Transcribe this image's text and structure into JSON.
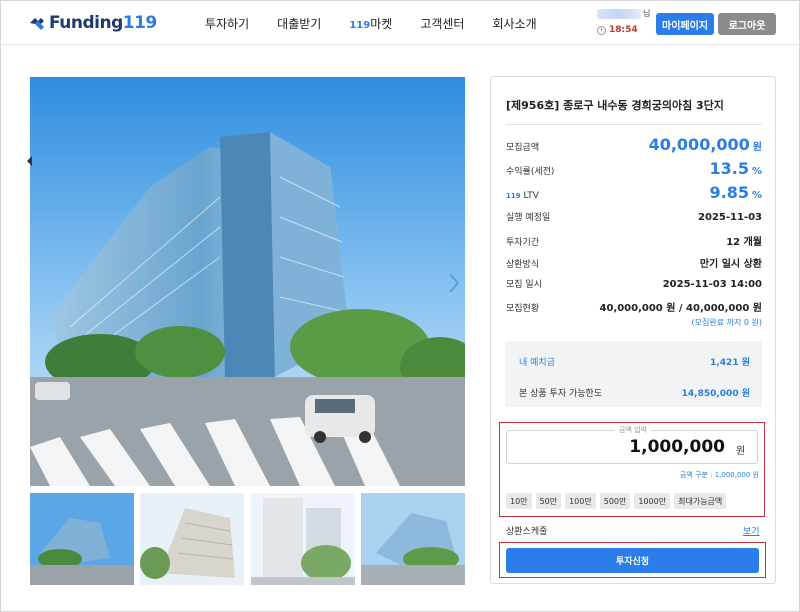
{
  "header": {
    "logo_prefix": "Funding",
    "logo_number": "119",
    "nav": [
      {
        "label": "투자하기"
      },
      {
        "label": "대출받기"
      },
      {
        "prefix": "119",
        "label": "마켓"
      },
      {
        "label": "고객센터"
      },
      {
        "label": "회사소개"
      }
    ],
    "user_suffix": "님",
    "session_timer": "18:54",
    "mypage_label": "마이페이지",
    "logout_label": "로그아웃"
  },
  "product": {
    "title": "[제956호] 종로구 내수동 경희궁의아침 3단지",
    "rows": [
      {
        "label": "모집금액",
        "value": "40,000,000",
        "unit": "원",
        "highlight": true
      },
      {
        "label": "수익률(세전)",
        "value": "13.5",
        "unit": "%",
        "highlight": true
      },
      {
        "label_prefix": "119",
        "label": " LTV",
        "value": "9.85",
        "unit": "%",
        "highlight": true
      },
      {
        "label": "실행 예정일",
        "value": "2025-11-03"
      },
      {
        "label": "투자기간",
        "value": "12 개월"
      },
      {
        "label": "상환방식",
        "value": "만기 일시 상환"
      },
      {
        "label": "모집 일시",
        "value": "2025-11-03 14:00"
      },
      {
        "label": "모집현황",
        "value": "40,000,000 원 / 40,000,000 원"
      }
    ],
    "complete_note": "(모집완료 까지 0 원)"
  },
  "balance": {
    "deposit_label": "내 예치금",
    "deposit_value": "1,421 원",
    "limit_label": "본 상품 투자 가능한도",
    "limit_value": "14,850,000 원"
  },
  "amount": {
    "legend": "금액 입력",
    "value": "1,000,000",
    "unit": "원",
    "caption": "금액 구분 : 1,000,000 원",
    "quick_buttons": [
      "10만",
      "50만",
      "100만",
      "500만",
      "1000만",
      "최대가능금액"
    ]
  },
  "schedule": {
    "label": "상환스케줄",
    "link": "보기"
  },
  "invest_button": "투자신청",
  "colors": {
    "accent": "#2b7de9",
    "highlight_outline": "#c9333e",
    "logout_gray": "#8c8c8c"
  }
}
